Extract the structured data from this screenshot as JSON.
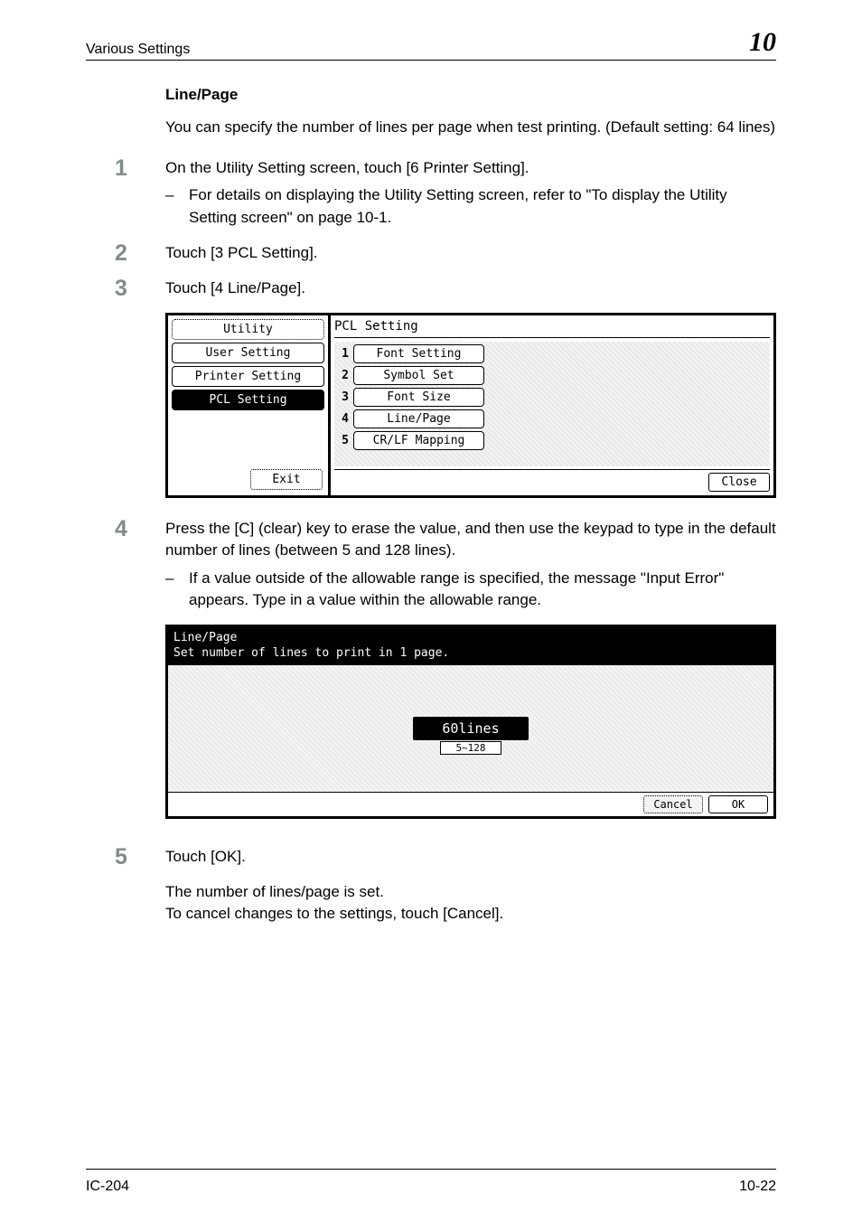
{
  "header": {
    "title": "Various Settings",
    "chapter_num": "10"
  },
  "section_heading": "Line/Page",
  "intro": "You can specify the number of lines per page when test printing. (Default setting: 64 lines)",
  "steps": {
    "s1": {
      "num": "1",
      "text": "On the Utility Setting screen, touch [6 Printer Setting].",
      "sub": "For details on displaying the Utility Setting screen, refer to \"To display the Utility Setting screen\" on page 10-1."
    },
    "s2": {
      "num": "2",
      "text": "Touch [3 PCL Setting]."
    },
    "s3": {
      "num": "3",
      "text": "Touch [4 Line/Page]."
    },
    "s4": {
      "num": "4",
      "text": "Press the [C] (clear) key to erase the value, and then use the keypad to type in the default number of lines (between 5 and 128 lines).",
      "sub": "If a value outside of the allowable range is specified, the message \"Input Error\" appears. Type in a value within the allowable range."
    },
    "s5": {
      "num": "5",
      "text": "Touch [OK]."
    }
  },
  "result": {
    "l1": "The number of lines/page is set.",
    "l2": "To cancel changes to the settings, touch [Cancel]."
  },
  "ui1": {
    "crumbs": {
      "c1": "Utility",
      "c2": "User Setting",
      "c3": "Printer Setting",
      "c4": "PCL Setting"
    },
    "exit": "Exit",
    "title": "PCL Setting",
    "items": {
      "i1": {
        "n": "1",
        "label": "Font Setting"
      },
      "i2": {
        "n": "2",
        "label": "Symbol Set"
      },
      "i3": {
        "n": "3",
        "label": "Font Size"
      },
      "i4": {
        "n": "4",
        "label": "Line/Page"
      },
      "i5": {
        "n": "5",
        "label": "CR/LF Mapping"
      }
    },
    "close": "Close"
  },
  "ui2": {
    "title": "Line/Page",
    "subtitle": "Set number of lines to print in 1 page.",
    "value": "60lines",
    "range": "5~128",
    "cancel": "Cancel",
    "ok": "OK"
  },
  "footer": {
    "left": "IC-204",
    "right": "10-22"
  }
}
